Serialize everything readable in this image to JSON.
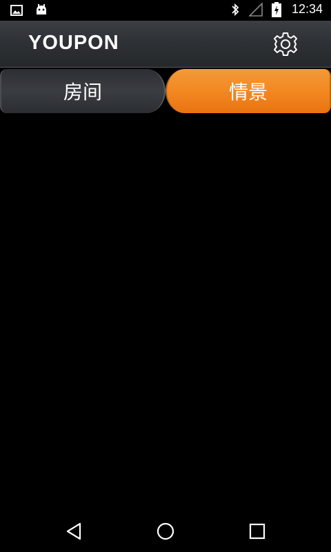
{
  "status_bar": {
    "time": "12:34",
    "left_icons": [
      "image-notification-icon",
      "android-notification-icon"
    ],
    "right_icons": [
      "bluetooth-icon",
      "signal-icon",
      "battery-charging-icon"
    ]
  },
  "header": {
    "title": "YOUPON",
    "settings_icon": "gear-icon"
  },
  "tabs": [
    {
      "label": "房间",
      "active": false
    },
    {
      "label": "情景",
      "active": true
    }
  ],
  "colors": {
    "accent": "#f38a22",
    "header_bg": "#2e3135",
    "background": "#000000"
  },
  "nav_bar": {
    "icons": [
      "back-icon",
      "home-icon",
      "recents-icon"
    ]
  }
}
